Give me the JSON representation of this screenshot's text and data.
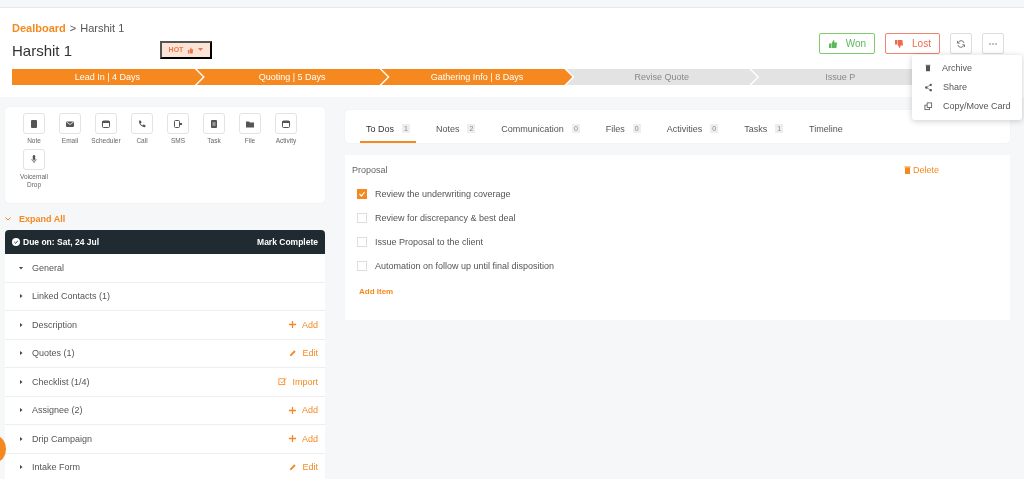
{
  "breadcrumb": {
    "link": "Dealboard",
    "separator": ">",
    "current": "Harshit 1"
  },
  "title": "Harshit 1",
  "priority": {
    "label": "HOT"
  },
  "actions": [
    {
      "kind": "won",
      "label": "Won"
    },
    {
      "kind": "lost",
      "label": "Lost"
    },
    {
      "kind": "refresh"
    },
    {
      "kind": "more"
    }
  ],
  "menu": [
    {
      "kind": "archive",
      "label": "Archive"
    },
    {
      "kind": "share",
      "label": "Share"
    },
    {
      "kind": "copy",
      "label": "Copy/Move Card"
    }
  ],
  "stages": [
    {
      "label": "Lead In | 4 Days",
      "done": true
    },
    {
      "label": "Quoting | 5 Days",
      "done": true
    },
    {
      "label": "Gathering Info | 8 Days",
      "done": true
    },
    {
      "label": "Revise Quote",
      "done": false
    },
    {
      "label": "Issue P",
      "done": false
    }
  ],
  "quick_actions": [
    {
      "kind": "note",
      "label": "Note"
    },
    {
      "kind": "email",
      "label": "Email"
    },
    {
      "kind": "calendar",
      "label": "Scheduler"
    },
    {
      "kind": "call",
      "label": "Call"
    },
    {
      "kind": "sms",
      "label": "SMS"
    },
    {
      "kind": "task",
      "label": "Task"
    },
    {
      "kind": "file",
      "label": "File"
    },
    {
      "kind": "calendar",
      "label": "Activity"
    },
    {
      "kind": "mic",
      "label": "Voicemail Drop"
    }
  ],
  "expand_all": "Expand All",
  "due": {
    "label": "Due on: Sat, 24 Jul",
    "action": "Mark Complete"
  },
  "sections": [
    {
      "label": "General",
      "expanded": true
    },
    {
      "label": "Linked Contacts (1)",
      "expanded": false
    },
    {
      "label": "Description",
      "expanded": false,
      "action": {
        "kind": "add",
        "label": "Add"
      }
    },
    {
      "label": "Quotes (1)",
      "expanded": false,
      "action": {
        "kind": "edit",
        "label": "Edit"
      }
    },
    {
      "label": "Checklist (1/4)",
      "expanded": false,
      "action": {
        "kind": "import",
        "label": "Import"
      }
    },
    {
      "label": "Assignee (2)",
      "expanded": false,
      "action": {
        "kind": "add",
        "label": "Add"
      }
    },
    {
      "label": "Drip Campaign",
      "expanded": false,
      "action": {
        "kind": "add",
        "label": "Add"
      }
    },
    {
      "label": "Intake Form",
      "expanded": false,
      "action": {
        "kind": "edit",
        "label": "Edit"
      }
    }
  ],
  "tabs": [
    {
      "label": "To Dos",
      "count": "1",
      "selected": true
    },
    {
      "label": "Notes",
      "count": "2",
      "selected": false
    },
    {
      "label": "Communication",
      "count": "0",
      "selected": false
    },
    {
      "label": "Files",
      "count": "0",
      "selected": false
    },
    {
      "label": "Activities",
      "count": "0",
      "selected": false
    },
    {
      "label": "Tasks",
      "count": "1",
      "selected": false
    },
    {
      "label": "Timeline",
      "selected": false
    }
  ],
  "checklist": {
    "title": "Proposal",
    "delete": "Delete",
    "add": "Add Item",
    "items": [
      {
        "label": "Review the underwriting coverage",
        "checked": true
      },
      {
        "label": "Review for discrepancy & best deal",
        "checked": false
      },
      {
        "label": "Issue Proposal to the client",
        "checked": false
      },
      {
        "label": "Automation on follow up until final disposition",
        "checked": false
      }
    ]
  }
}
